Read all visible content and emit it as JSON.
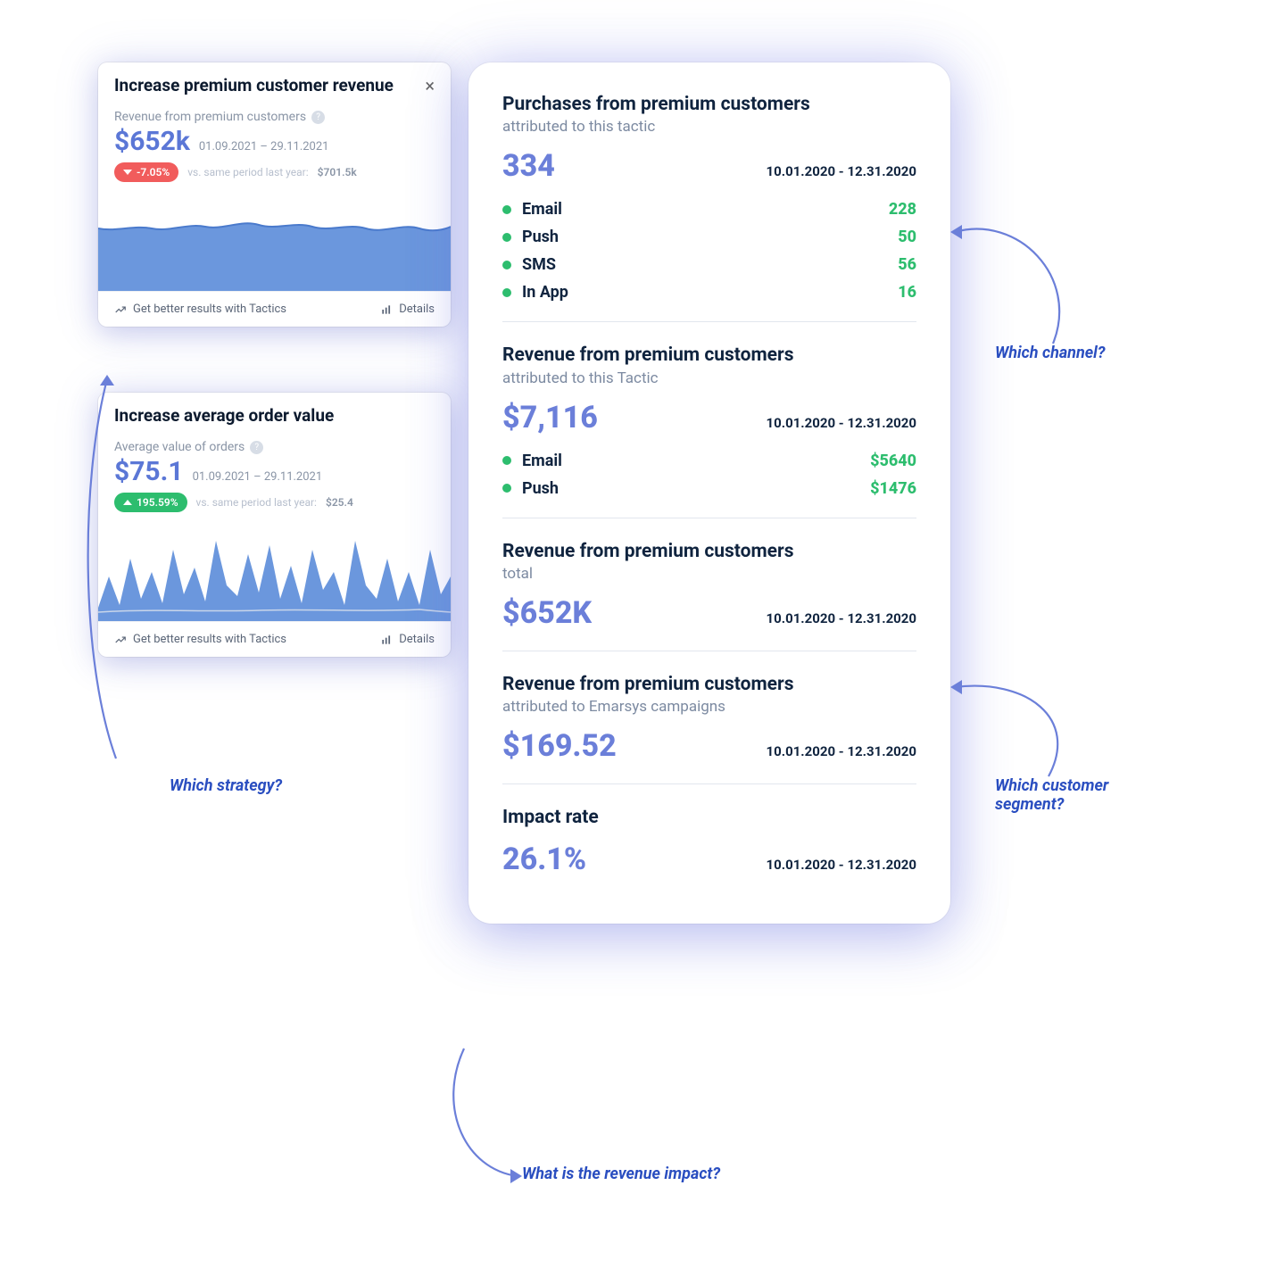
{
  "cards": {
    "revenue": {
      "title": "Increase premium customer revenue",
      "metric_label": "Revenue from premium customers",
      "value": "$652k",
      "date_range": "01.09.2021 – 29.11.2021",
      "delta": "-7.05%",
      "compare_label": "vs. same period last year:",
      "compare_value": "$701.5k",
      "footer_tactics": "Get better results with Tactics",
      "footer_details": "Details"
    },
    "aov": {
      "title": "Increase average order value",
      "metric_label": "Average value of orders",
      "value": "$75.1",
      "date_range": "01.09.2021 – 29.11.2021",
      "delta": "195.59%",
      "compare_label": "vs. same period last year:",
      "compare_value": "$25.4",
      "footer_tactics": "Get better results with Tactics",
      "footer_details": "Details"
    }
  },
  "panel": {
    "purchases": {
      "title": "Purchases from premium customers",
      "subtitle": "attributed to this tactic",
      "value": "334",
      "date_range": "10.01.2020 - 12.31.2020",
      "channels": [
        {
          "name": "Email",
          "value": "228"
        },
        {
          "name": "Push",
          "value": "50"
        },
        {
          "name": "SMS",
          "value": "56"
        },
        {
          "name": "In App",
          "value": "16"
        }
      ]
    },
    "revenue_tactic": {
      "title": "Revenue from premium customers",
      "subtitle": "attributed to this Tactic",
      "value": "$7,116",
      "date_range": "10.01.2020 - 12.31.2020",
      "channels": [
        {
          "name": "Email",
          "value": "$5640"
        },
        {
          "name": "Push",
          "value": "$1476"
        }
      ]
    },
    "revenue_total": {
      "title": "Revenue from premium customers",
      "subtitle": "total",
      "value": "$652K",
      "date_range": "10.01.2020 - 12.31.2020"
    },
    "revenue_emarsys": {
      "title": "Revenue from premium customers",
      "subtitle": "attributed to Emarsys campaigns",
      "value": "$169.52",
      "date_range": "10.01.2020 - 12.31.2020"
    },
    "impact": {
      "title": "Impact rate",
      "value": "26.1%",
      "date_range": "10.01.2020 - 12.31.2020"
    }
  },
  "annotations": {
    "strategy": "Which strategy?",
    "channel": "Which channel?",
    "segment": "Which customer segment?",
    "impact": "What is the revenue impact?"
  },
  "chart_data": [
    {
      "type": "area",
      "title": "Revenue from premium customers",
      "series_style": "flat",
      "note": "qualitative shape only — no axis labels in source"
    },
    {
      "type": "area",
      "title": "Average value of orders",
      "series_style": "spiky",
      "note": "qualitative shape only — no axis labels in source"
    }
  ]
}
